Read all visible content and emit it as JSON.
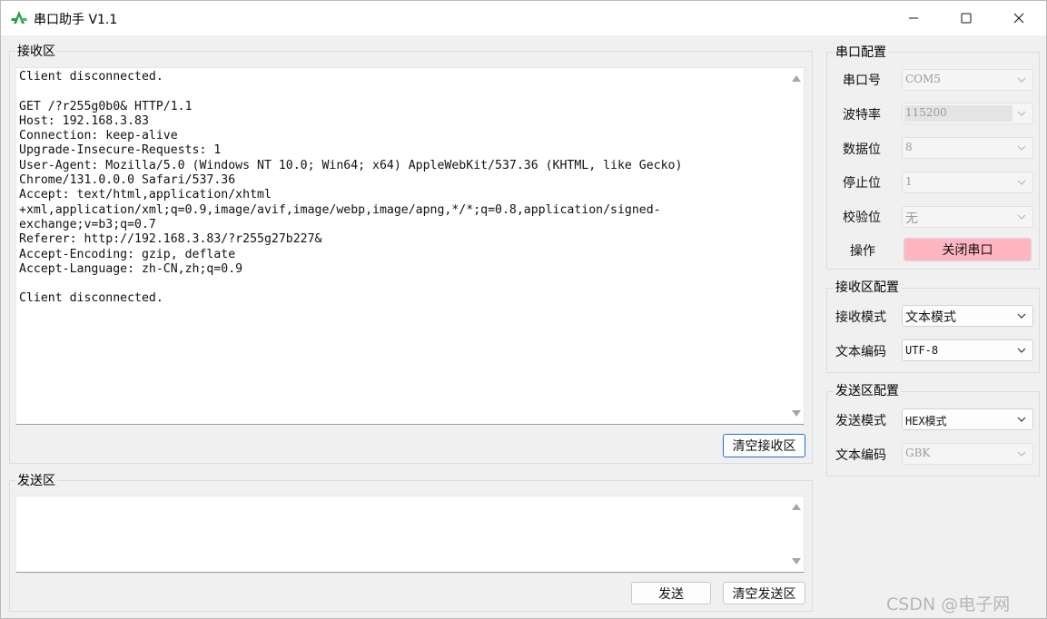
{
  "window": {
    "title": "串口助手 V1.1"
  },
  "receive_area": {
    "label": "接收区",
    "lines": [
      "Client disconnected.",
      "",
      "GET /?r255g0b0& HTTP/1.1",
      "Host: 192.168.3.83",
      "Connection: keep-alive",
      "Upgrade-Insecure-Requests: 1",
      "User-Agent: Mozilla/5.0 (Windows NT 10.0; Win64; x64) AppleWebKit/537.36 (KHTML, like Gecko)",
      "Chrome/131.0.0.0 Safari/537.36",
      "Accept: text/html,application/xhtml",
      "+xml,application/xml;q=0.9,image/avif,image/webp,image/apng,*/*;q=0.8,application/signed-",
      "exchange;v=b3;q=0.7",
      "Referer: http://192.168.3.83/?r255g27b227&",
      "Accept-Encoding: gzip, deflate",
      "Accept-Language: zh-CN,zh;q=0.9",
      "",
      "Client disconnected."
    ],
    "clear_button": "清空接收区"
  },
  "send_area": {
    "label": "发送区",
    "value": "",
    "send_button": "发送",
    "clear_button": "清空发送区"
  },
  "serial_config": {
    "label": "串口配置",
    "port": {
      "label": "串口号",
      "value": "COM5"
    },
    "baud": {
      "label": "波特率",
      "value": "115200"
    },
    "data_bits": {
      "label": "数据位",
      "value": "8"
    },
    "stop_bits": {
      "label": "停止位",
      "value": "1"
    },
    "parity": {
      "label": "校验位",
      "value": "无"
    },
    "action": {
      "label": "操作",
      "button": "关闭串口"
    }
  },
  "receive_config": {
    "label": "接收区配置",
    "mode": {
      "label": "接收模式",
      "value": "文本模式"
    },
    "encoding": {
      "label": "文本编码",
      "value": "UTF-8"
    }
  },
  "send_config": {
    "label": "发送区配置",
    "mode": {
      "label": "发送模式",
      "value": "HEX模式"
    },
    "encoding": {
      "label": "文本编码",
      "value": "GBK"
    }
  },
  "watermark": {
    "text": "CSDN @电子网"
  },
  "colors": {
    "close_port_bg": "#ffb6c1",
    "focus_border": "#1e6fd0"
  }
}
